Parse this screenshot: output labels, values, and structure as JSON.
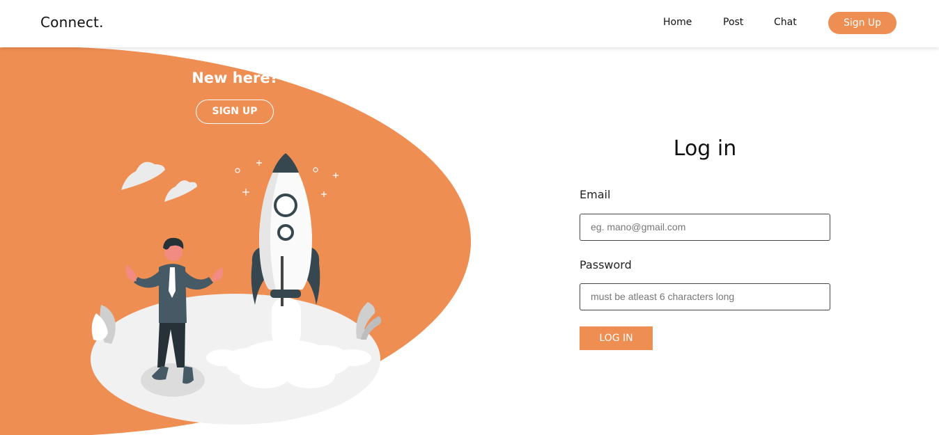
{
  "navbar": {
    "brand": "Connect.",
    "links": [
      "Home",
      "Post",
      "Chat"
    ],
    "signup_label": "Sign Up"
  },
  "left_panel": {
    "heading": "New here?",
    "signup_label": "SIGN UP"
  },
  "login_form": {
    "title": "Log in",
    "email_label": "Email",
    "email_placeholder": "eg. mano@gmail.com",
    "password_label": "Password",
    "password_placeholder": "must be atleast 6 characters long",
    "submit_label": "LOG IN"
  },
  "colors": {
    "accent": "#ef8e53",
    "background": "#ffffff",
    "text": "#111111"
  },
  "icons": [
    "rocket-illustration",
    "person-illustration",
    "cloud-icon",
    "sparkle-icon"
  ]
}
